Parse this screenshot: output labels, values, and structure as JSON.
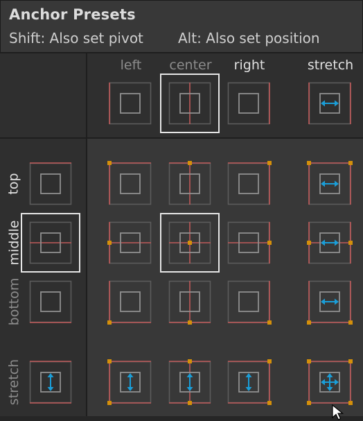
{
  "header": {
    "title": "Anchor Presets",
    "shift_hint": "Shift: Also set pivot",
    "alt_hint": "Alt: Also set position"
  },
  "columns": [
    {
      "key": "left",
      "label": "left",
      "highlight": false
    },
    {
      "key": "center",
      "label": "center",
      "highlight": false
    },
    {
      "key": "right",
      "label": "right",
      "highlight": true
    },
    {
      "key": "stretch",
      "label": "stretch",
      "highlight": true
    }
  ],
  "rows": [
    {
      "key": "top",
      "label": "top",
      "highlight": true
    },
    {
      "key": "middle",
      "label": "middle",
      "highlight": true
    },
    {
      "key": "bottom",
      "label": "bottom",
      "highlight": false
    },
    {
      "key": "stretch",
      "label": "stretch",
      "highlight": false
    }
  ],
  "selection": {
    "column": "center",
    "row": "middle"
  },
  "colors": {
    "anchor_line": "#c05a5a",
    "pivot_dot": "#d4900a",
    "arrow": "#1a9ed8",
    "outer_square": "#5c5c5c",
    "inner_square": "#8f8f8f",
    "selection_border": "#e6e6e6"
  }
}
